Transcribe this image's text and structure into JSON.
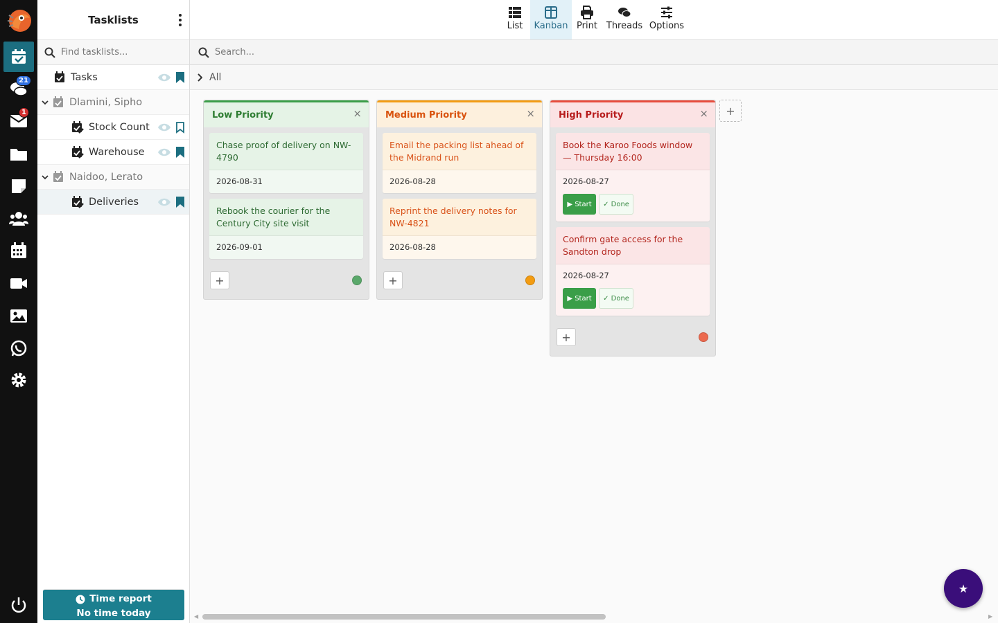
{
  "colors": {
    "rail": "#111111",
    "accent": "#1c6e80",
    "low": "#3a9e48",
    "medium": "#f39c12",
    "high": "#e74c3c"
  },
  "rail": {
    "items": [
      {
        "icon": "calendar-check-icon",
        "active": true
      },
      {
        "icon": "chat-icon",
        "badge": "21"
      },
      {
        "icon": "mail-icon",
        "badge": "1"
      },
      {
        "icon": "folder-icon"
      },
      {
        "icon": "note-icon"
      },
      {
        "icon": "users-icon"
      },
      {
        "icon": "calendar-icon"
      },
      {
        "icon": "video-icon"
      },
      {
        "icon": "image-icon"
      },
      {
        "icon": "whatsapp-icon"
      },
      {
        "icon": "gear-icon"
      }
    ],
    "power_icon": "power-icon"
  },
  "sidebar": {
    "title": "Tasklists",
    "search_placeholder": "Find tasklists...",
    "items": [
      {
        "label": "Tasks",
        "bookmarked": true
      },
      {
        "label": "Dlamini, Sipho",
        "group": true
      },
      {
        "label": "Stock Count",
        "bookmarked": false
      },
      {
        "label": "Warehouse",
        "bookmarked": true
      },
      {
        "label": "Naidoo, Lerato",
        "group": true
      },
      {
        "label": "Deliveries",
        "bookmarked": true,
        "selected": true
      }
    ],
    "time_report": {
      "title": "Time report",
      "subtitle": "No time today"
    }
  },
  "toolbar": {
    "buttons": [
      {
        "label": "List"
      },
      {
        "label": "Kanban",
        "active": true
      },
      {
        "label": "Print"
      },
      {
        "label": "Threads"
      },
      {
        "label": "Options"
      }
    ]
  },
  "main": {
    "search_placeholder": "Search...",
    "breadcrumb": "All"
  },
  "columns": [
    {
      "title": "Low Priority",
      "cards": [
        {
          "title": "Chase proof of delivery on NW-4790",
          "date": "2026-08-31"
        },
        {
          "title": "Rebook the courier for the Century City site visit",
          "date": "2026-09-01"
        }
      ]
    },
    {
      "title": "Medium Priority",
      "cards": [
        {
          "title": "Email the packing list ahead of the Midrand run",
          "date": "2026-08-28"
        },
        {
          "title": "Reprint the delivery notes for NW-4821",
          "date": "2026-08-28"
        }
      ]
    },
    {
      "title": "High Priority",
      "cards": [
        {
          "title": "Book the Karoo Foods window — Thursday 16:00",
          "date": "2026-08-27",
          "start": "▶ Start",
          "done": "✓ Done"
        },
        {
          "title": "Confirm gate access for the Sandton drop",
          "date": "2026-08-27",
          "start": "▶ Start",
          "done": "✓ Done"
        }
      ]
    }
  ],
  "add_symbol": "+",
  "close_symbol": "×",
  "fab_symbol": "★"
}
